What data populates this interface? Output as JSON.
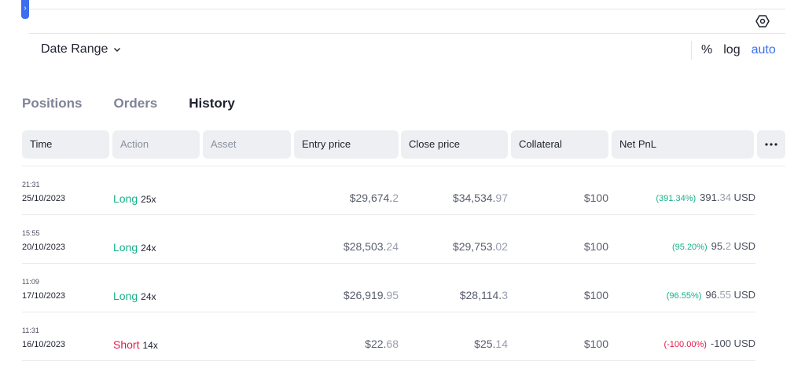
{
  "sidebar_toggle": {
    "glyph": "›"
  },
  "toolbar": {
    "date_range_label": "Date Range",
    "scale_options": [
      "%",
      "log",
      "auto"
    ],
    "scale_active": "auto"
  },
  "tabs": [
    {
      "label": "Positions"
    },
    {
      "label": "Orders"
    },
    {
      "label": "History",
      "active": true
    }
  ],
  "table": {
    "columns": [
      "Time",
      "Action",
      "Asset",
      "Entry price",
      "Close price",
      "Collateral",
      "Net PnL"
    ],
    "rows": [
      {
        "time": "21:31",
        "date": "25/10/2023",
        "action": "Long",
        "leverage": "25x",
        "entry_int": "$29,674.",
        "entry_dec": "2",
        "close_int": "$34,534.",
        "close_dec": "97",
        "collateral": "$100",
        "pnl_pct": "(391.34%)",
        "pnl_int": "391.",
        "pnl_dec": "34",
        "pnl_unit": " USD"
      },
      {
        "time": "15:55",
        "date": "20/10/2023",
        "action": "Long",
        "leverage": "24x",
        "entry_int": "$28,503.",
        "entry_dec": "24",
        "close_int": "$29,753.",
        "close_dec": "02",
        "collateral": "$100",
        "pnl_pct": "(95.20%)",
        "pnl_int": "95.",
        "pnl_dec": "2",
        "pnl_unit": " USD"
      },
      {
        "time": "11:09",
        "date": "17/10/2023",
        "action": "Long",
        "leverage": "24x",
        "entry_int": "$26,919.",
        "entry_dec": "95",
        "close_int": "$28,114.",
        "close_dec": "3",
        "collateral": "$100",
        "pnl_pct": "(96.55%)",
        "pnl_int": "96.",
        "pnl_dec": "55",
        "pnl_unit": " USD"
      },
      {
        "time": "11:31",
        "date": "16/10/2023",
        "action": "Short",
        "leverage": "14x",
        "entry_int": "$22.",
        "entry_dec": "68",
        "close_int": "$25.",
        "close_dec": "14",
        "collateral": "$100",
        "pnl_pct": "(-100.00%)",
        "pnl_int": "-100",
        "pnl_dec": "",
        "pnl_unit": " USD"
      }
    ]
  },
  "icons": {
    "settings": "hexagon-settings-icon",
    "chevron": "chevron-down-icon",
    "more": "more-horizontal-icon"
  },
  "colors": {
    "accent": "#3c6ef0",
    "long": "#17b08a",
    "short": "#e6194b"
  }
}
